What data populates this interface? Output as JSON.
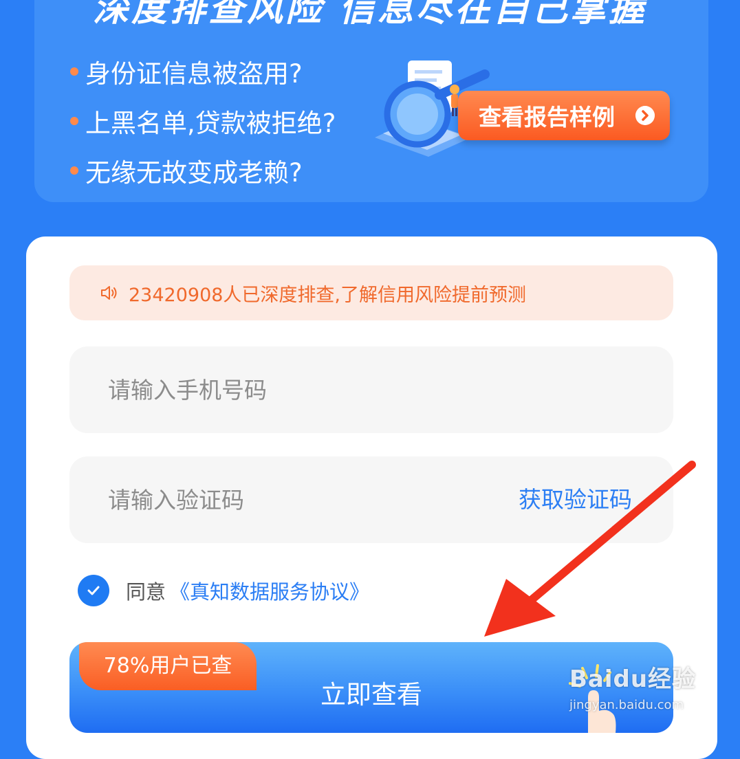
{
  "banner": {
    "headline": "深度排查风险  信息尽在自己掌握",
    "bullets": [
      "身份证信息被盗用?",
      "上黑名单,贷款被拒绝?",
      "无缘无故变成老赖?"
    ],
    "sample_button": "查看报告样例"
  },
  "form": {
    "notice": "23420908人已深度排查,了解信用风险提前预测",
    "phone_placeholder": "请输入手机号码",
    "code_placeholder": "请输入验证码",
    "get_code": "获取验证码",
    "agree_prefix": "同意",
    "agreement_link": "《真知数据服务协议》",
    "agree_checked": true,
    "submit_label": "立即查看",
    "badge": "78%用户已查"
  },
  "watermark": {
    "brand": "Baidu经验",
    "url": "jingyan.baidu.com"
  },
  "colors": {
    "page_bg": "#2b7ff6",
    "accent_orange": "#fa5e24",
    "link_blue": "#2b7ef4",
    "annotation_red": "#f2311d"
  }
}
